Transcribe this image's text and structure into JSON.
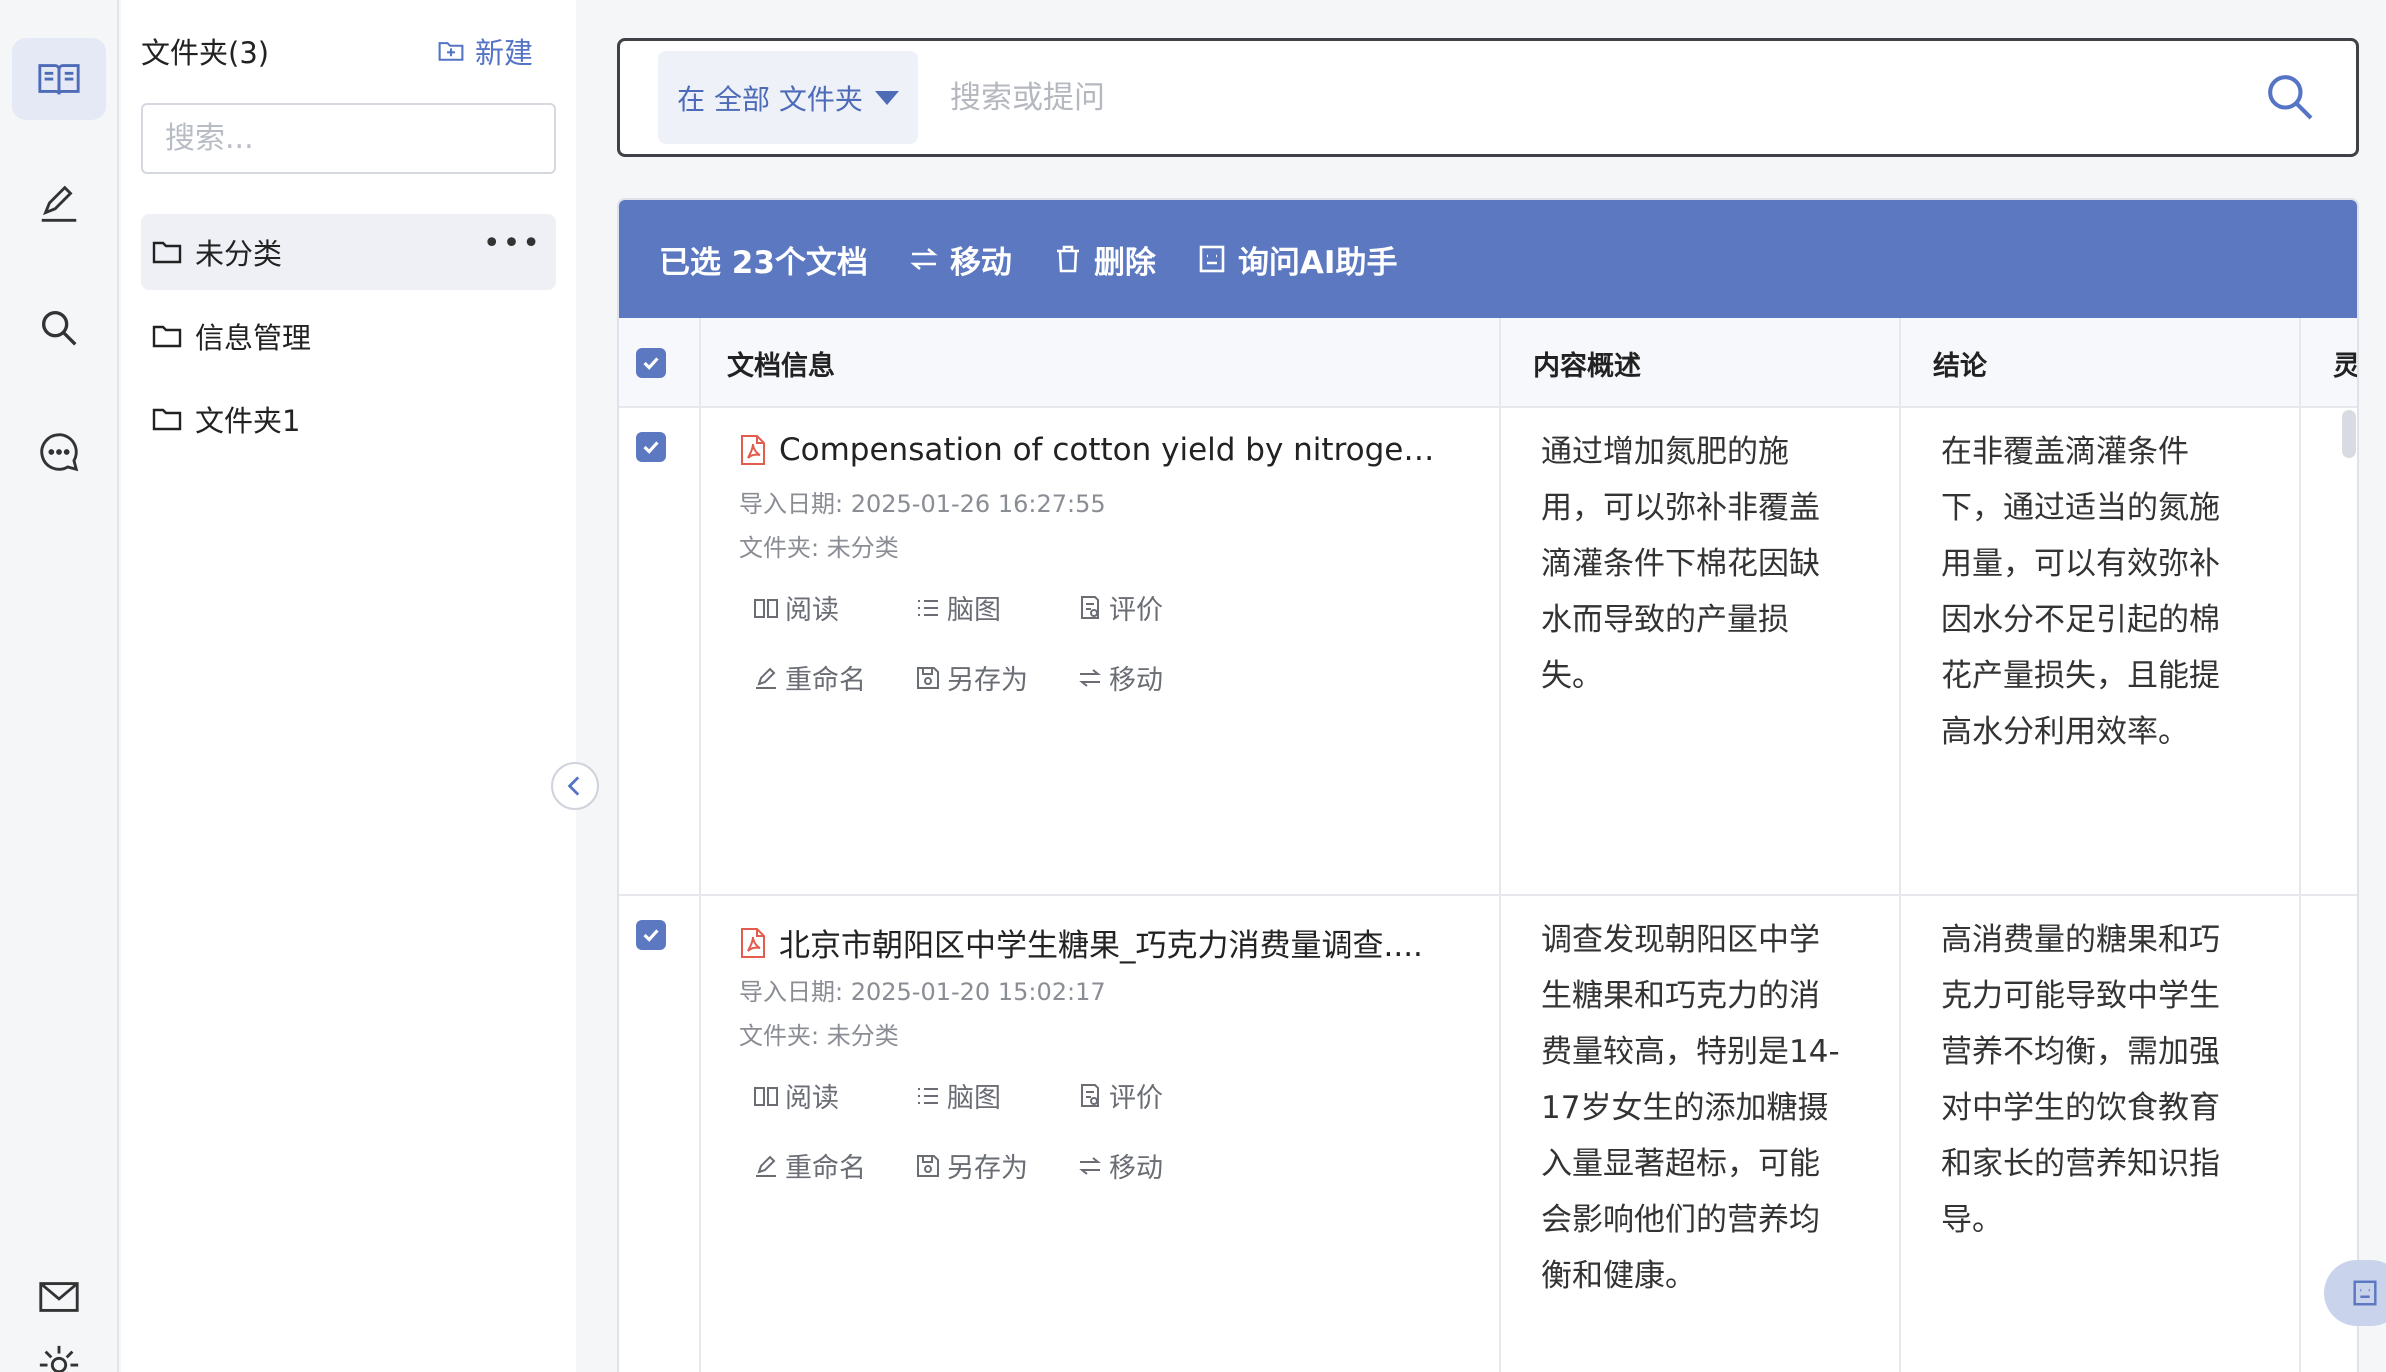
{
  "rail": {
    "items": [
      {
        "icon": "book-icon",
        "active": true
      },
      {
        "icon": "edit-icon",
        "active": false
      },
      {
        "icon": "search-icon",
        "active": false
      },
      {
        "icon": "chat-icon",
        "active": false
      },
      {
        "icon": "mail-icon",
        "active": false
      }
    ]
  },
  "folders": {
    "title": "文件夹(3)",
    "new_label": "新建",
    "search_placeholder": "搜索...",
    "items": [
      {
        "label": "未分类",
        "active": true
      },
      {
        "label": "信息管理",
        "active": false
      },
      {
        "label": "文件夹1",
        "active": false
      }
    ]
  },
  "search": {
    "scope_label": "在 全部 文件夹",
    "placeholder": "搜索或提问"
  },
  "selection_bar": {
    "summary": "已选 23个文档",
    "move": "移动",
    "delete": "删除",
    "ask_ai": "询问AI助手"
  },
  "table": {
    "headers": {
      "doc_info": "文档信息",
      "summary": "内容概述",
      "conclusion": "结论",
      "next_partial": "灵"
    },
    "row_actions": {
      "read": "阅读",
      "mindmap": "脑图",
      "review": "评价",
      "rename": "重命名",
      "save_as": "另存为",
      "move": "移动"
    },
    "rows": [
      {
        "title": "Compensation of cotton yield by nitrogen fer...",
        "import_date": "导入日期: 2025-01-26 16:27:55",
        "folder": "文件夹: 未分类",
        "summary_lines": [
          "通过增加氮肥的施",
          "用，可以弥补非覆盖",
          "滴灌条件下棉花因缺",
          "水而导致的产量损",
          "失。"
        ],
        "conclusion_lines": [
          "在非覆盖滴灌条件",
          "下，通过适当的氮施",
          "用量，可以有效弥补",
          "因水分不足引起的棉",
          "花产量损失，且能提",
          "高水分利用效率。"
        ]
      },
      {
        "title": "北京市朝阳区中学生糖果_巧克力消费量调查....",
        "import_date": "导入日期: 2025-01-20 15:02:17",
        "folder": "文件夹: 未分类",
        "summary_lines": [
          "调查发现朝阳区中学",
          "生糖果和巧克力的消",
          "费量较高，特别是14-",
          "17岁女生的添加糖摄",
          "入量显著超标，可能",
          "会影响他们的营养均",
          "衡和健康。"
        ],
        "conclusion_lines": [
          "高消费量的糖果和巧",
          "克力可能导致中学生",
          "营养不均衡，需加强",
          "对中学生的饮食教育",
          "和家长的营养知识指",
          "导。"
        ]
      }
    ]
  },
  "colors": {
    "accent": "#5b78c1",
    "accent_text": "#5574c6",
    "rail_active_bg": "#e4e9f5"
  }
}
